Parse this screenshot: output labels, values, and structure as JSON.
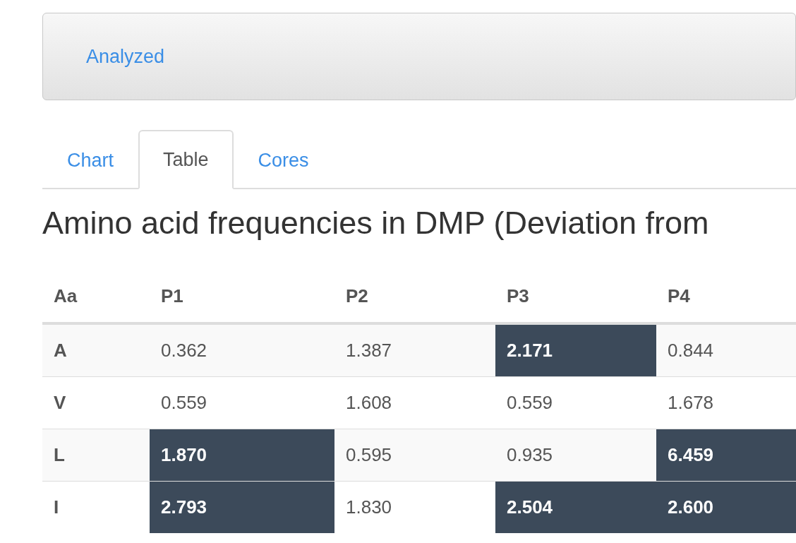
{
  "panel": {
    "link": "Analyzed"
  },
  "tabs": [
    {
      "label": "Chart",
      "selected": false
    },
    {
      "label": "Table",
      "selected": true
    },
    {
      "label": "Cores",
      "selected": false
    }
  ],
  "heading": "Amino acid frequencies in DMP (Deviation from",
  "table": {
    "columns": [
      "Aa",
      "P1",
      "P2",
      "P3",
      "P4"
    ],
    "rows": [
      {
        "cells": [
          {
            "text": "A",
            "highlighted": false
          },
          {
            "text": "0.362",
            "highlighted": false
          },
          {
            "text": "1.387",
            "highlighted": false
          },
          {
            "text": "2.171",
            "highlighted": true
          },
          {
            "text": "0.844",
            "highlighted": false
          }
        ]
      },
      {
        "cells": [
          {
            "text": "V",
            "highlighted": false
          },
          {
            "text": "0.559",
            "highlighted": false
          },
          {
            "text": "1.608",
            "highlighted": false
          },
          {
            "text": "0.559",
            "highlighted": false
          },
          {
            "text": "1.678",
            "highlighted": false
          }
        ]
      },
      {
        "cells": [
          {
            "text": "L",
            "highlighted": false
          },
          {
            "text": "1.870",
            "highlighted": true
          },
          {
            "text": "0.595",
            "highlighted": false
          },
          {
            "text": "0.935",
            "highlighted": false
          },
          {
            "text": "6.459",
            "highlighted": true
          }
        ]
      },
      {
        "cells": [
          {
            "text": "I",
            "highlighted": false
          },
          {
            "text": "2.793",
            "highlighted": true
          },
          {
            "text": "1.830",
            "highlighted": false
          },
          {
            "text": "2.504",
            "highlighted": true
          },
          {
            "text": "2.600",
            "highlighted": true
          }
        ]
      }
    ]
  }
}
